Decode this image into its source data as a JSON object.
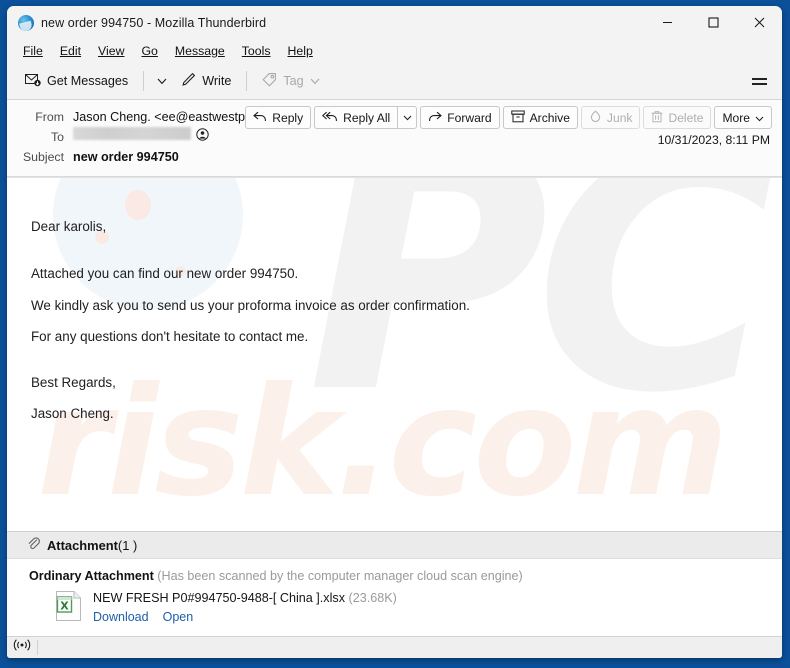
{
  "window": {
    "title": "new order 994750 - Mozilla Thunderbird",
    "app_icon": "thunderbird-icon",
    "controls": {
      "minimize": "minimize-icon",
      "maximize": "maximize-icon",
      "close": "close-icon"
    }
  },
  "menubar": {
    "items": [
      {
        "label": "File",
        "accel": "F"
      },
      {
        "label": "Edit",
        "accel": "E"
      },
      {
        "label": "View",
        "accel": "V"
      },
      {
        "label": "Go",
        "accel": "G"
      },
      {
        "label": "Message",
        "accel": "M"
      },
      {
        "label": "Tools",
        "accel": "T"
      },
      {
        "label": "Help",
        "accel": "H"
      }
    ]
  },
  "toolbar": {
    "get_messages": "Get Messages",
    "write": "Write",
    "tag": "Tag",
    "menu_button": "app-menu-icon"
  },
  "header": {
    "from_label": "From",
    "from_value": "Jason Cheng. <ee@eastwestpay.ru>",
    "to_label": "To",
    "to_value": "",
    "subject_label": "Subject",
    "subject_value": "new order 994750",
    "date": "10/31/2023, 8:11 PM",
    "actions": {
      "reply": "Reply",
      "reply_all": "Reply All",
      "forward": "Forward",
      "archive": "Archive",
      "junk": "Junk",
      "delete": "Delete",
      "more": "More"
    }
  },
  "body": {
    "watermark_primary": "PC",
    "watermark_secondary": "risk.com",
    "paragraphs": [
      "Dear karolis,",
      "Attached you can find our new order 994750.",
      "We kindly ask you to send us your proforma invoice as order confirmation.",
      "For any questions don't hesitate to contact me.",
      "Best Regards,",
      "Jason Cheng."
    ]
  },
  "attachment": {
    "bar_label": "Attachment",
    "bar_count": "(1 )",
    "kind_label": "Ordinary Attachment",
    "scan_note": "(Has been scanned by the computer manager cloud scan engine)",
    "file_name": "NEW FRESH P0#994750-9488-[ China ].xlsx",
    "file_size": "(23.68K)",
    "download_link": "Download",
    "open_link": "Open"
  },
  "statusbar": {
    "connection_icon": "online-status-icon"
  },
  "colors": {
    "frame_blue": "#0b5099",
    "link_blue": "#1d5fa8",
    "toolbar_bg": "#f3f3f3",
    "attachment_bar_bg": "#ebebeb",
    "watermark_gray": "#f2f2f2",
    "watermark_peach": "#fcf0ea"
  }
}
